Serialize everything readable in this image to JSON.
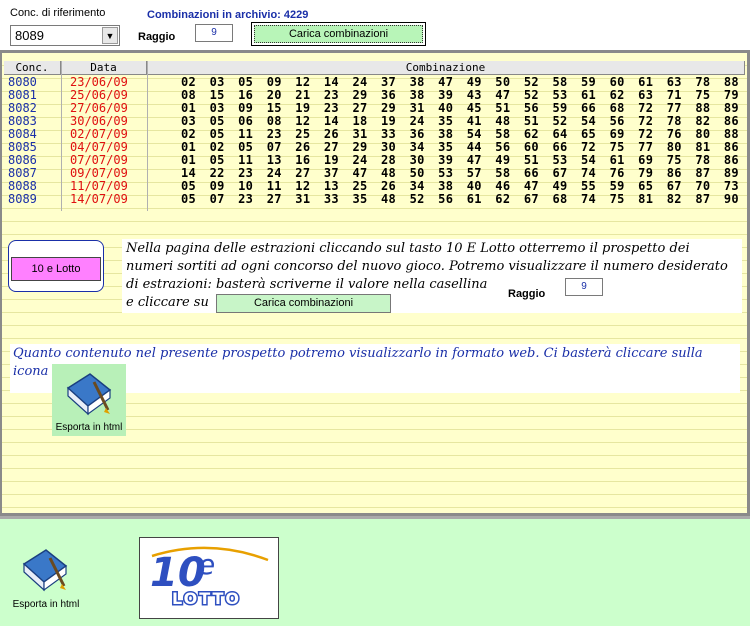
{
  "header": {
    "conc_label": "Conc. di riferimento",
    "conc_value": "8089",
    "archive_label": "Combinazioni in archivio: 4229",
    "raggio_label": "Raggio",
    "raggio_value": "9",
    "load_button": "Carica combinazioni"
  },
  "table": {
    "columns": [
      "Conc.",
      "Data",
      "Combinazione"
    ],
    "rows": [
      {
        "conc": "8080",
        "date": "23/06/09",
        "numbers": "02 03 05 09 12 14 24 37 38 47 49 50 52 58 59 60 61 63 78 88"
      },
      {
        "conc": "8081",
        "date": "25/06/09",
        "numbers": "08 15 16 20 21 23 29 36 38 39 43 47 52 53 61 62 63 71 75 79"
      },
      {
        "conc": "8082",
        "date": "27/06/09",
        "numbers": "01 03 09 15 19 23 27 29 31 40 45 51 56 59 66 68 72 77 88 89"
      },
      {
        "conc": "8083",
        "date": "30/06/09",
        "numbers": "03 05 06 08 12 14 18 19 24 35 41 48 51 52 54 56 72 78 82 86"
      },
      {
        "conc": "8084",
        "date": "02/07/09",
        "numbers": "02 05 11 23 25 26 31 33 36 38 54 58 62 64 65 69 72 76 80 88"
      },
      {
        "conc": "8085",
        "date": "04/07/09",
        "numbers": "01 02 05 07 26 27 29 30 34 35 44 56 60 66 72 75 77 80 81 86"
      },
      {
        "conc": "8086",
        "date": "07/07/09",
        "numbers": "01 05 11 13 16 19 24 28 30 39 47 49 51 53 54 61 69 75 78 86"
      },
      {
        "conc": "8087",
        "date": "09/07/09",
        "numbers": "14 22 23 24 27 37 47 48 50 53 57 58 66 67 74 76 79 86 87 89"
      },
      {
        "conc": "8088",
        "date": "11/07/09",
        "numbers": "05 09 10 11 12 13 25 26 34 38 40 46 47 49 55 59 65 67 70 73"
      },
      {
        "conc": "8089",
        "date": "14/07/09",
        "numbers": "05 07 23 27 31 33 35 48 52 56 61 62 67 68 74 75 81 82 87 90"
      }
    ]
  },
  "info": {
    "button_10": "10 e Lotto",
    "line1": "Nella pagina delle estrazioni cliccando sul tasto 10 E Lotto otterremo il prospetto dei",
    "line2": "numeri sortiti ad ogni concorso del nuovo gioco. Potremo visualizzare il numero desiderato",
    "line3": "di estrazioni: basterà scriverne il valore nella casellina",
    "line4": "e cliccare su",
    "raggio_label": "Raggio",
    "raggio_value": "9",
    "inline_button": "Carica combinazioni",
    "web_text_1": "Quanto contenuto nel presente prospetto potremo visualizzarlo in formato web. Ci basterà cliccare sulla",
    "web_text_2": "icona",
    "export_label": "Esporta in html"
  },
  "footer": {
    "export_label": "Esporta in html",
    "logo_text_10": "10",
    "logo_text_e": "e",
    "logo_text_lotto": "LOTTO"
  },
  "colors": {
    "grid_bg": "#ffffcc",
    "conc_blue": "#1a2fa8",
    "date_red": "#e01010",
    "footer_green": "#ccffcc",
    "button_pink": "#ff80ff",
    "button_green": "#b8f5b8"
  }
}
